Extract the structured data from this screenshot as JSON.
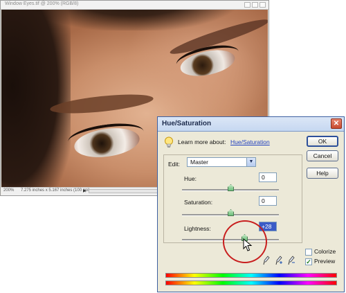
{
  "document": {
    "title": "Window Eyes.tif @ 200% (RGB/8)",
    "zoom": "200%",
    "info": "7.275 inches x 5.167 inches (100 ppi)",
    "nav_arrow": "▶"
  },
  "dialog": {
    "title": "Hue/Saturation",
    "close_glyph": "✕",
    "learn_label": "Learn more about:",
    "learn_link": "Hue/Saturation",
    "edit_label": "Edit:",
    "edit_value": "Master",
    "hue_label": "Hue:",
    "hue_value": "0",
    "saturation_label": "Saturation:",
    "saturation_value": "0",
    "lightness_label": "Lightness:",
    "lightness_value": "+28",
    "buttons": {
      "ok": "OK",
      "cancel": "Cancel",
      "help": "Help"
    },
    "colorize_label": "Colorize",
    "colorize_checked": false,
    "preview_label": "Preview",
    "preview_checked": true,
    "check_glyph": "✓",
    "dropdown_glyph": "▼"
  },
  "colors": {
    "accent_blue": "#3a5bc7",
    "highlight_red": "#c81e1e",
    "slider_green": "#6bbf7a"
  },
  "icons": [
    "lightbulb-icon",
    "eyedropper-icon",
    "eyedropper-plus-icon",
    "eyedropper-minus-icon",
    "mouse-cursor-icon",
    "close-icon"
  ]
}
